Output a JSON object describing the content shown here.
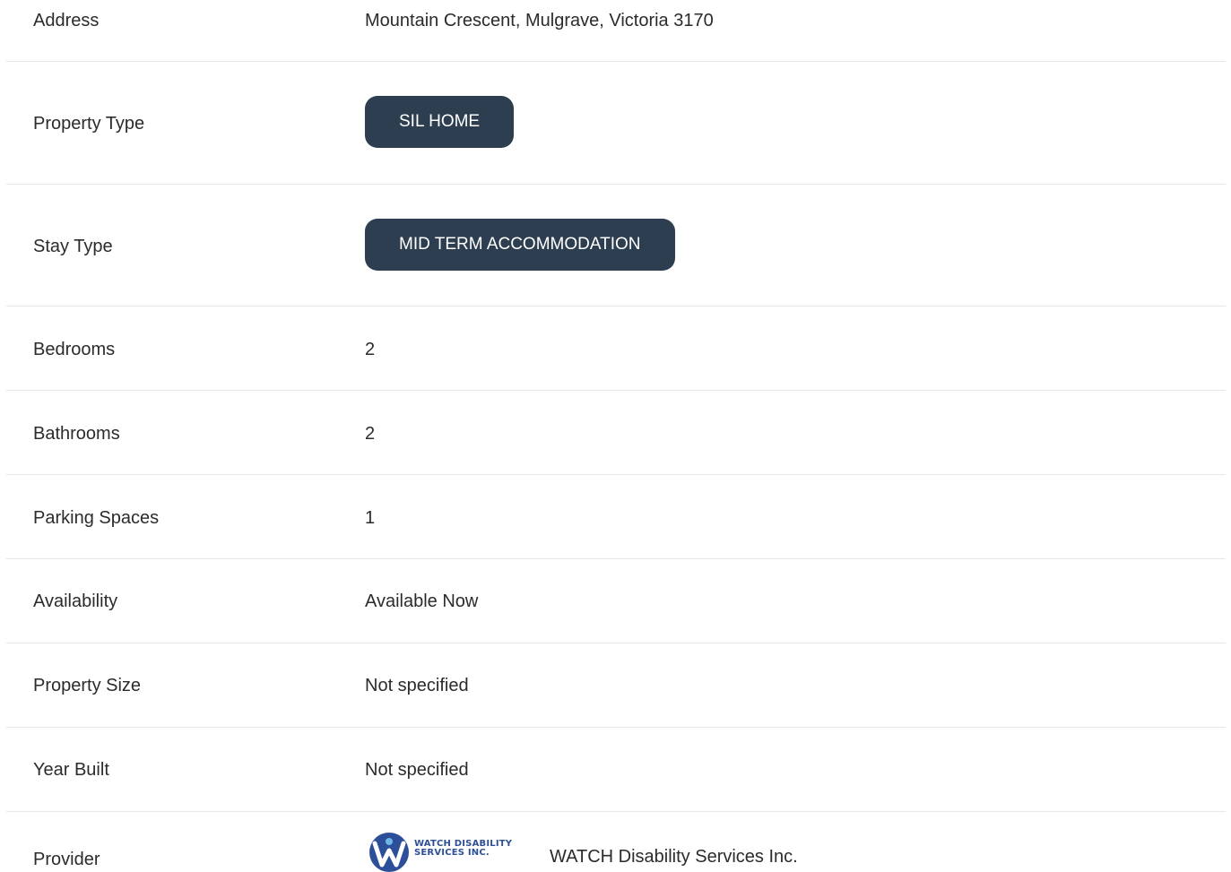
{
  "details": {
    "address": {
      "label": "Address",
      "value": "Mountain Crescent, Mulgrave, Victoria 3170"
    },
    "property_type": {
      "label": "Property Type",
      "value": "SIL HOME"
    },
    "stay_type": {
      "label": "Stay Type",
      "value": "MID TERM ACCOMMODATION"
    },
    "bedrooms": {
      "label": "Bedrooms",
      "value": "2"
    },
    "bathrooms": {
      "label": "Bathrooms",
      "value": "2"
    },
    "parking": {
      "label": "Parking Spaces",
      "value": "1"
    },
    "availability": {
      "label": "Availability",
      "value": "Available Now"
    },
    "property_size": {
      "label": "Property Size",
      "value": "Not specified"
    },
    "year_built": {
      "label": "Year Built",
      "value": "Not specified"
    },
    "provider": {
      "label": "Provider",
      "logo_line1": "WATCH DISABILITY",
      "logo_line2": "SERVICES INC.",
      "name": "WATCH Disability Services Inc."
    }
  },
  "colors": {
    "pill_bg": "#2c3e50",
    "pill_text": "#ffffff",
    "divider": "#e4e6e8",
    "logo_blue": "#2d4f9a"
  }
}
